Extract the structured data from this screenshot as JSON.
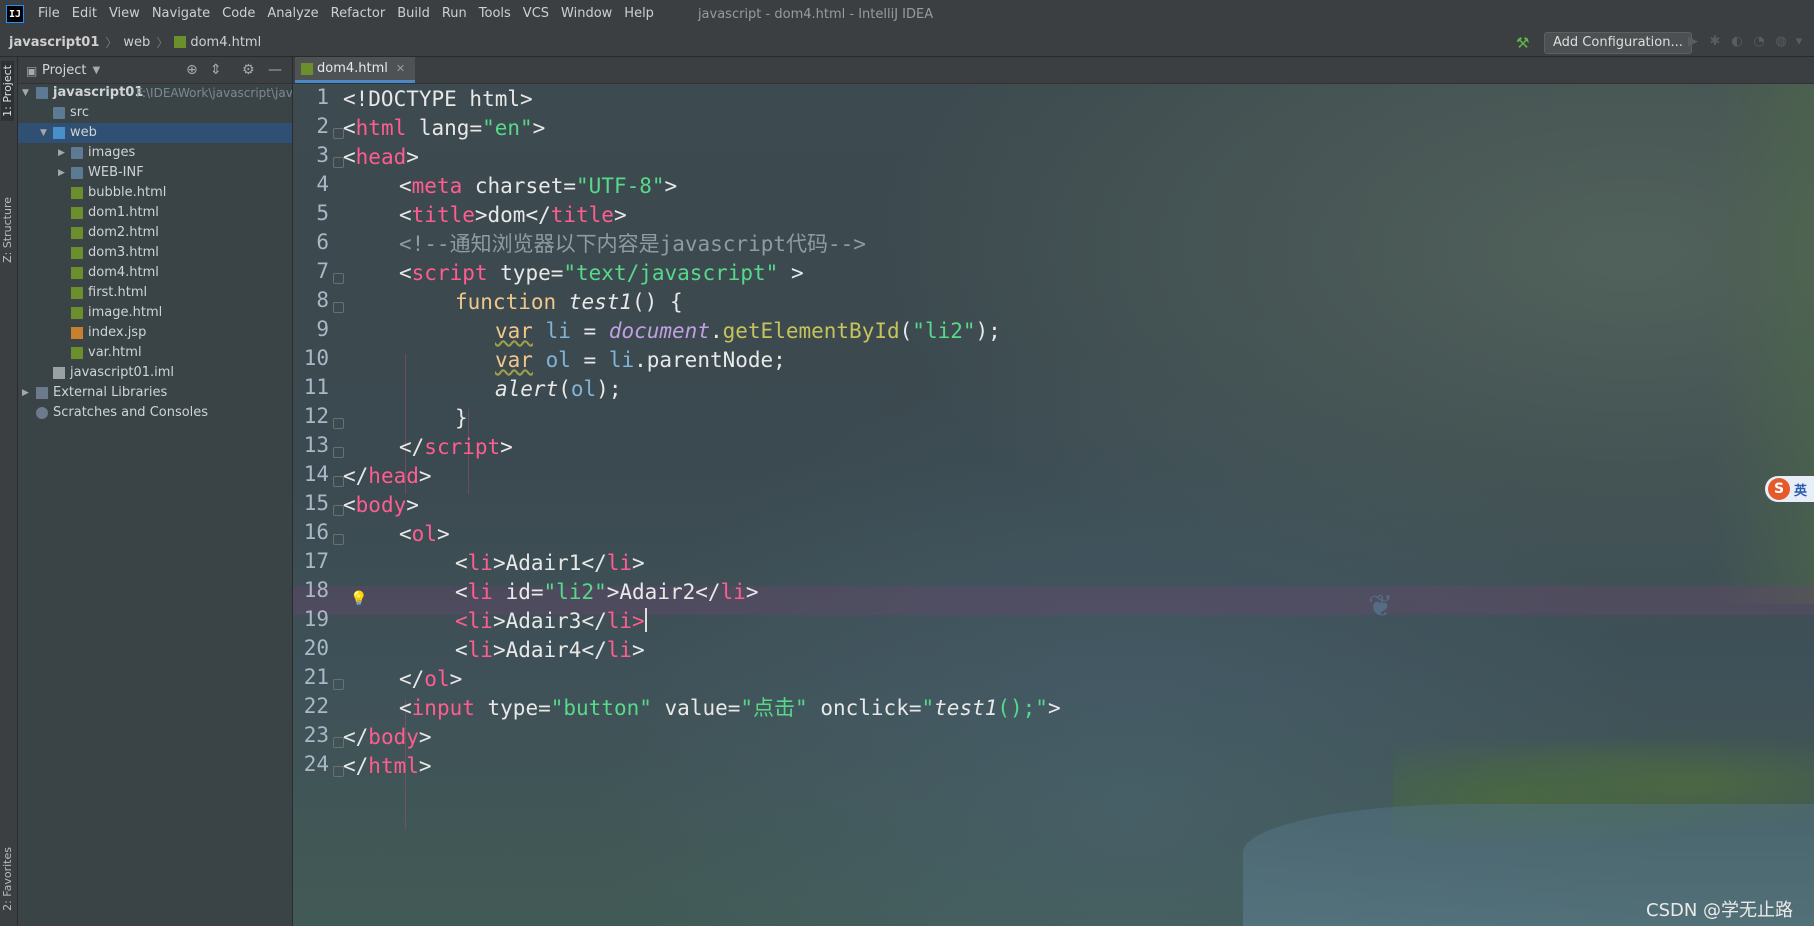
{
  "menubar": {
    "items": [
      "File",
      "Edit",
      "View",
      "Navigate",
      "Code",
      "Analyze",
      "Refactor",
      "Build",
      "Run",
      "Tools",
      "VCS",
      "Window",
      "Help"
    ],
    "title": "javascript - dom4.html - IntelliJ IDEA"
  },
  "navbar": {
    "crumbs": [
      "javascript01",
      "web",
      "dom4.html"
    ],
    "add_config": "Add Configuration..."
  },
  "tool_strip": {
    "project": "1: Project",
    "structure": "Z: Structure",
    "favorites": "2: Favorites"
  },
  "project_panel": {
    "title": "Project",
    "tree": [
      {
        "label": "javascript01",
        "hint": "F:\\IDEAWork\\javascript\\jav",
        "icon": "folder-icon"
      },
      {
        "label": "src",
        "icon": "folder-icon"
      },
      {
        "label": "web",
        "icon": "web-folder-icon"
      },
      {
        "label": "images",
        "icon": "folder-icon"
      },
      {
        "label": "WEB-INF",
        "icon": "folder-icon"
      },
      {
        "label": "bubble.html",
        "icon": "html-file-icon"
      },
      {
        "label": "dom1.html",
        "icon": "html-file-icon"
      },
      {
        "label": "dom2.html",
        "icon": "html-file-icon"
      },
      {
        "label": "dom3.html",
        "icon": "html-file-icon"
      },
      {
        "label": "dom4.html",
        "icon": "html-file-icon"
      },
      {
        "label": "first.html",
        "icon": "html-file-icon"
      },
      {
        "label": "image.html",
        "icon": "html-file-icon"
      },
      {
        "label": "index.jsp",
        "icon": "jsp-file-icon"
      },
      {
        "label": "var.html",
        "icon": "html-file-icon"
      },
      {
        "label": "javascript01.iml",
        "icon": "iml-file-icon"
      },
      {
        "label": "External Libraries",
        "icon": "library-icon"
      },
      {
        "label": "Scratches and Consoles",
        "icon": "scratches-icon"
      }
    ]
  },
  "editor": {
    "tab": "dom4.html",
    "line_numbers": [
      "1",
      "2",
      "3",
      "4",
      "5",
      "6",
      "7",
      "8",
      "9",
      "10",
      "11",
      "12",
      "13",
      "14",
      "15",
      "16",
      "17",
      "18",
      "19",
      "20",
      "21",
      "22",
      "23",
      "24"
    ],
    "code": {
      "l1": [
        "<!DOCTYPE html>"
      ],
      "l2": [
        "<",
        "html",
        " lang=",
        "\"en\"",
        ">"
      ],
      "l3": [
        "<",
        "head",
        ">"
      ],
      "l4": [
        "<",
        "meta",
        " charset=",
        "\"UTF-8\"",
        ">"
      ],
      "l5": [
        "<",
        "title",
        ">dom</",
        "title",
        ">"
      ],
      "l6": [
        "<!--通知浏览器以下内容是javascript代码-->"
      ],
      "l7": [
        "<",
        "script",
        " type=",
        "\"text/javascript\"",
        " >"
      ],
      "l8": [
        "function ",
        "test1",
        "() {"
      ],
      "l9": [
        "var",
        " li",
        " = ",
        "document",
        ".",
        "getElementById",
        "(",
        "\"li2\"",
        ");"
      ],
      "l10": [
        "var",
        " ol",
        " = ",
        "li",
        ".parentNode;"
      ],
      "l11": [
        "alert",
        "(",
        "ol",
        ");"
      ],
      "l12": [
        "}"
      ],
      "l13": [
        "</",
        "script",
        ">"
      ],
      "l14": [
        "</",
        "head",
        ">"
      ],
      "l15": [
        "<",
        "body",
        ">"
      ],
      "l16": [
        "<",
        "ol",
        ">"
      ],
      "l17": [
        "<",
        "li",
        ">Adair1</",
        "li",
        ">"
      ],
      "l18": [
        "<",
        "li",
        " id=",
        "\"li2\"",
        ">Adair2</",
        "li",
        ">"
      ],
      "l19": [
        "<",
        "li",
        ">Adair3</",
        "li",
        ">"
      ],
      "l20": [
        "<",
        "li",
        ">Adair4</",
        "li",
        ">"
      ],
      "l21": [
        "</",
        "ol",
        ">"
      ],
      "l22": [
        "<",
        "input",
        " type=",
        "\"button\"",
        " value=",
        "\"点击\"",
        " onclick=",
        "\"",
        "test1",
        "();\"",
        ">"
      ],
      "l23": [
        "</",
        "body",
        ">"
      ],
      "l24": [
        "</",
        "html",
        ">"
      ]
    }
  },
  "overlay": {
    "ime_badge": "英",
    "watermark": "CSDN @学无止路"
  },
  "colors": {
    "tag": "#ff5d8f",
    "string": "#57d98a",
    "comment": "#8f9ba3",
    "keyword": "#f0c78a",
    "selection": "#2f4f73",
    "accent": "#4a88c7"
  }
}
